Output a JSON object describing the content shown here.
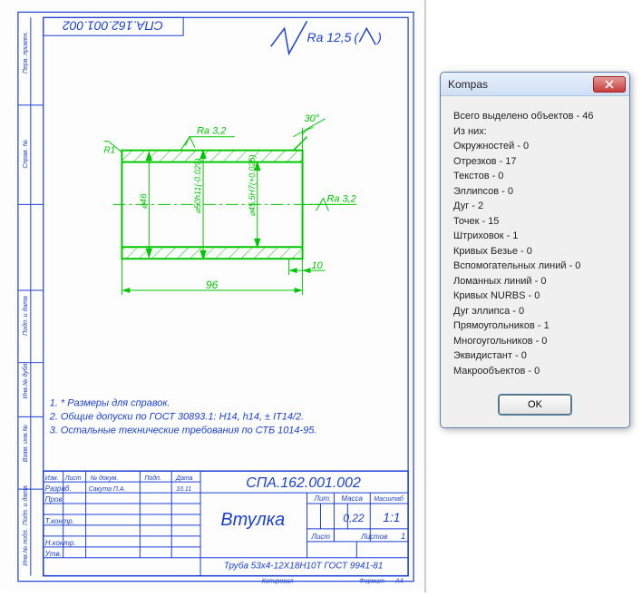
{
  "dialog": {
    "title": "Kompas",
    "header": "Всего выделено объектов - 46",
    "subheader": "Из них:",
    "rows": [
      "Окружностей - 0",
      "Отрезков - 17",
      "Текстов - 0",
      "Эллипсов - 0",
      "Дуг - 2",
      "Точек - 15",
      "Штриховок - 1",
      "Кривых Безье - 0",
      "Вспомогательных линий - 0",
      "Ломанных линий - 0",
      "Кривых NURBS - 0",
      "Дуг эллипса - 0",
      "Прямоугольников - 1",
      "Многоугольников - 0",
      "Эквидистант - 0",
      "Макрообъектов - 0"
    ],
    "ok": "OK"
  },
  "drawing": {
    "code_mirror": "СПА.162.001.002",
    "code": "СПА.162.001.002",
    "surface": "Ra 12,5",
    "ra_top": "Ra 3,2",
    "ra_right": "Ra 3,2",
    "angle": "30°",
    "dim_bottom": "96",
    "dim_offset": "10",
    "dim_d1": "⌀46",
    "dim_d2": "⌀50h11(-0.029)",
    "dim_d3": "⌀45,5H7(+0.025)",
    "chamfer": "R1",
    "notes": {
      "n1": "1. * Размеры для справок.",
      "n2": "2. Общие допуски по ГОСТ 30893.1: H14, h14, ± IT14/2.",
      "n3": "3. Остальные технические требования по СТБ 1014-95."
    },
    "title_block": {
      "part_name": "Втулка",
      "material": "Труба 53x4-12Х18Н10Т ГОСТ 9941-81",
      "mass": "0,22",
      "scale": "1:1",
      "sheet": "1",
      "sheets_label": "Листов",
      "sheet_label": "Лист",
      "mass_label": "Масса",
      "scale_label": "Масштаб",
      "lit_label": "Лит.",
      "format_label": "Формат",
      "format": "А4",
      "copied_label": "Копировал",
      "col_izm": "Изм.",
      "col_list": "Лист",
      "col_doc": "№ докум.",
      "col_podp": "Подп.",
      "col_data": "Дата",
      "row_razrab": "Разраб.",
      "row_prov": "Пров.",
      "row_tkontr": "Т.контр.",
      "row_nkontr": "Н.контр.",
      "row_utv": "Утв.",
      "dev_name": "Сакута П.А.",
      "date_val": "10.11"
    },
    "side_labels": {
      "l1": "Перв. примен.",
      "l2": "Справ. №",
      "l3": "Подп. и дата",
      "l4": "Инв.№ дубл.",
      "l5": "Взам. инв.№",
      "l6": "Подп. и дата",
      "l7": "Инв.№ подл."
    }
  }
}
